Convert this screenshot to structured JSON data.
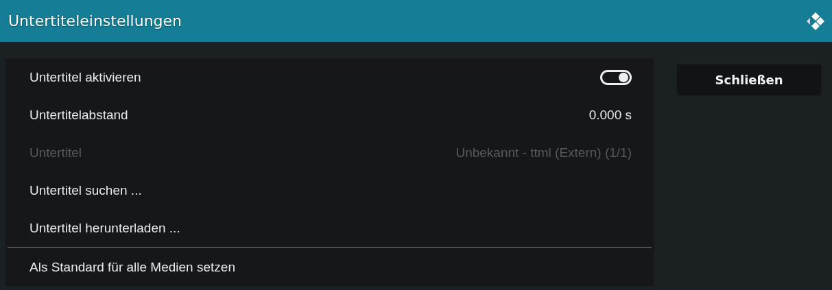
{
  "window": {
    "title": "Untertiteleinstellungen"
  },
  "items": [
    {
      "kind": "toggle",
      "label": "Untertitel aktivieren",
      "on": true,
      "disabled": false
    },
    {
      "kind": "value",
      "label": "Untertitelabstand",
      "value": "0.000 s",
      "disabled": false
    },
    {
      "kind": "value",
      "label": "Untertitel",
      "value": "Unbekannt - ttml (Extern) (1/1)",
      "disabled": true
    },
    {
      "kind": "plain",
      "label": "Untertitel suchen ...",
      "disabled": false
    },
    {
      "kind": "plain",
      "label": "Untertitel herunterladen ...",
      "disabled": false
    }
  ],
  "footer_items": [
    {
      "label": "Als Standard für alle Medien setzen",
      "disabled": false
    }
  ],
  "buttons": [
    "Schließen"
  ]
}
